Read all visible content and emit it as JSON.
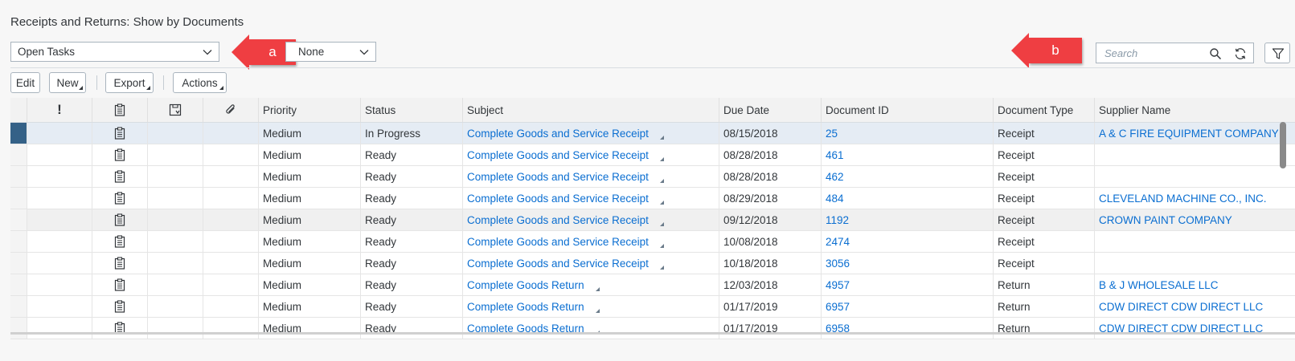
{
  "page": {
    "title": "Receipts and Returns: Show by Documents"
  },
  "filters": {
    "view_select": "Open Tasks",
    "group_select": "None"
  },
  "callouts": {
    "a": "a",
    "b": "b"
  },
  "search": {
    "placeholder": "Search"
  },
  "toolbar": {
    "edit": "Edit",
    "new": "New",
    "export": "Export",
    "actions": "Actions"
  },
  "table": {
    "headers": {
      "priority_icon": "!",
      "priority": "Priority",
      "status": "Status",
      "subject": "Subject",
      "due_date": "Due Date",
      "document_id": "Document ID",
      "document_type": "Document Type",
      "supplier_name": "Supplier Name"
    },
    "rows": [
      {
        "priority": "Medium",
        "status": "In Progress",
        "subject": "Complete Goods and Service Receipt",
        "due_date": "08/15/2018",
        "document_id": "25",
        "document_type": "Receipt",
        "supplier_name": "A & C FIRE EQUIPMENT COMPANY, I..."
      },
      {
        "priority": "Medium",
        "status": "Ready",
        "subject": "Complete Goods and Service Receipt",
        "due_date": "08/28/2018",
        "document_id": "461",
        "document_type": "Receipt",
        "supplier_name": ""
      },
      {
        "priority": "Medium",
        "status": "Ready",
        "subject": "Complete Goods and Service Receipt",
        "due_date": "08/28/2018",
        "document_id": "462",
        "document_type": "Receipt",
        "supplier_name": ""
      },
      {
        "priority": "Medium",
        "status": "Ready",
        "subject": "Complete Goods and Service Receipt",
        "due_date": "08/29/2018",
        "document_id": "484",
        "document_type": "Receipt",
        "supplier_name": "CLEVELAND MACHINE CO., INC."
      },
      {
        "priority": "Medium",
        "status": "Ready",
        "subject": "Complete Goods and Service Receipt",
        "due_date": "09/12/2018",
        "document_id": "1192",
        "document_type": "Receipt",
        "supplier_name": "CROWN PAINT COMPANY"
      },
      {
        "priority": "Medium",
        "status": "Ready",
        "subject": "Complete Goods and Service Receipt",
        "due_date": "10/08/2018",
        "document_id": "2474",
        "document_type": "Receipt",
        "supplier_name": ""
      },
      {
        "priority": "Medium",
        "status": "Ready",
        "subject": "Complete Goods and Service Receipt",
        "due_date": "10/18/2018",
        "document_id": "3056",
        "document_type": "Receipt",
        "supplier_name": ""
      },
      {
        "priority": "Medium",
        "status": "Ready",
        "subject": "Complete Goods Return",
        "due_date": "12/03/2018",
        "document_id": "4957",
        "document_type": "Return",
        "supplier_name": "B & J WHOLESALE LLC"
      },
      {
        "priority": "Medium",
        "status": "Ready",
        "subject": "Complete Goods Return",
        "due_date": "01/17/2019",
        "document_id": "6957",
        "document_type": "Return",
        "supplier_name": "CDW DIRECT CDW DIRECT LLC"
      },
      {
        "priority": "Medium",
        "status": "Ready",
        "subject": "Complete Goods Return",
        "due_date": "01/17/2019",
        "document_id": "6958",
        "document_type": "Return",
        "supplier_name": "CDW DIRECT CDW DIRECT LLC"
      }
    ]
  },
  "colors": {
    "accent": "#0a6ed1",
    "callout": "#ef3e42",
    "selected_marker": "#346187"
  }
}
